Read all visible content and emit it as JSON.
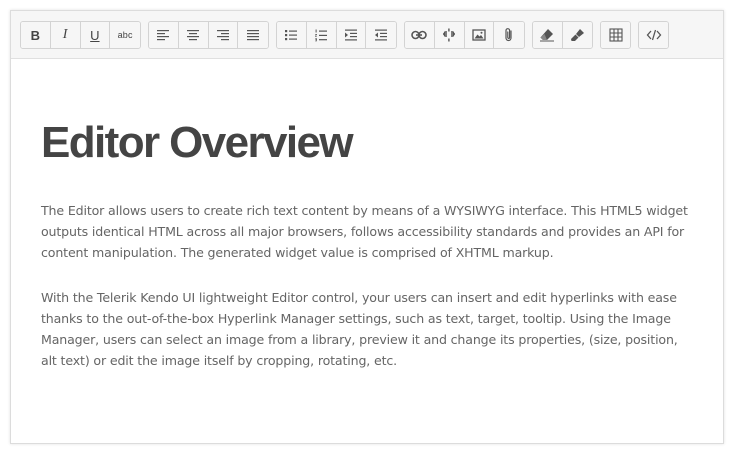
{
  "toolbar": {
    "bold_label": "B",
    "italic_label": "I",
    "underline_label": "U",
    "strikethrough_label": "abc"
  },
  "icons": {
    "bold": "bold-icon",
    "italic": "italic-icon",
    "underline": "underline-icon",
    "strikethrough": "strikethrough-icon",
    "justify_left": "align-left-icon",
    "justify_center": "align-center-icon",
    "justify_right": "align-right-icon",
    "justify_full": "align-justify-icon",
    "unordered_list": "bullet-list-icon",
    "ordered_list": "numbered-list-icon",
    "indent": "indent-icon",
    "outdent": "outdent-icon",
    "create_link": "link-icon",
    "unlink": "unlink-icon",
    "insert_image": "image-icon",
    "insert_file": "paperclip-icon",
    "clean_formatting": "eraser-icon",
    "format_painter": "paint-brush-icon",
    "table": "table-icon",
    "view_html": "code-icon"
  },
  "colors": {
    "toolbar_bg": "#f6f6f6",
    "border": "#d3d3d3",
    "title_text": "#444444",
    "body_text": "#656565",
    "icon": "#555555"
  },
  "content": {
    "title": "Editor Overview",
    "paragraph_1": "The Editor allows users to create rich text content by means of a WYSIWYG interface. This HTML5 widget outputs identical HTML across all major browsers, follows accessibility standards and provides an API for content manipulation. The generated widget value is comprised of XHTML markup.",
    "paragraph_2": "With the Telerik Kendo UI lightweight Editor control, your users can insert and edit hyperlinks with ease thanks to the out-of-the-box Hyperlink Manager settings, such as text, target, tooltip. Using the Image Manager, users can select an image from a library, preview it and change its properties, (size, position, alt text) or edit the image itself by cropping, rotating, etc."
  }
}
